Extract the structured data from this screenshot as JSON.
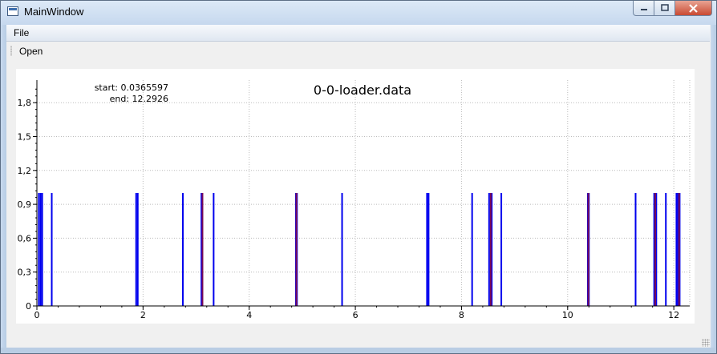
{
  "window": {
    "title": "MainWindow"
  },
  "menubar": {
    "file": "File"
  },
  "toolbar": {
    "open": "Open"
  },
  "plot": {
    "title": "0-0-loader.data",
    "start_label": "start: 0.0365597",
    "end_label": "end: 12.2926",
    "colors": {
      "event_blue": "#0000ee",
      "event_purple": "#7a0a55",
      "axis": "#000000",
      "grid": "#bbbbbb"
    }
  },
  "chart_data": {
    "type": "bar",
    "title": "0-0-loader.data",
    "xlabel": "",
    "ylabel": "",
    "xlim": [
      0,
      12.3
    ],
    "ylim": [
      0,
      2.0
    ],
    "grid": true,
    "x_ticks": [
      0,
      2,
      4,
      6,
      8,
      10,
      12
    ],
    "x_tick_labels": [
      "0",
      "2",
      "4",
      "6",
      "8",
      "10",
      "12"
    ],
    "y_ticks": [
      0,
      0.3,
      0.6,
      0.9,
      1.2,
      1.5,
      1.8
    ],
    "y_tick_labels": [
      "0",
      "0,3",
      "0,6",
      "0,9",
      "1,2",
      "1,5",
      "1,8"
    ],
    "series": [
      {
        "color": "#0000ee",
        "x": [
          0.0366,
          0.07,
          0.1,
          0.28,
          1.87,
          1.9,
          2.75,
          3.1,
          3.33,
          4.88,
          4.9,
          5.75,
          7.35,
          7.38,
          8.2,
          8.52,
          8.57,
          8.75,
          10.38,
          10.4,
          11.28,
          11.63,
          11.67,
          11.85,
          12.05,
          12.08,
          12.11
        ],
        "values": [
          1.0,
          1.0,
          1.0,
          1.0,
          1.0,
          1.0,
          1.0,
          1.0,
          1.0,
          1.0,
          1.0,
          1.0,
          1.0,
          1.0,
          1.0,
          1.0,
          1.0,
          1.0,
          1.0,
          1.0,
          1.0,
          1.0,
          1.0,
          1.0,
          1.0,
          1.0,
          1.0
        ]
      },
      {
        "color": "#7a0a55",
        "x": [
          3.12,
          4.89,
          8.55,
          10.39,
          11.65,
          12.1
        ],
        "values": [
          1.0,
          1.0,
          1.0,
          1.0,
          1.0,
          1.0
        ]
      }
    ]
  }
}
